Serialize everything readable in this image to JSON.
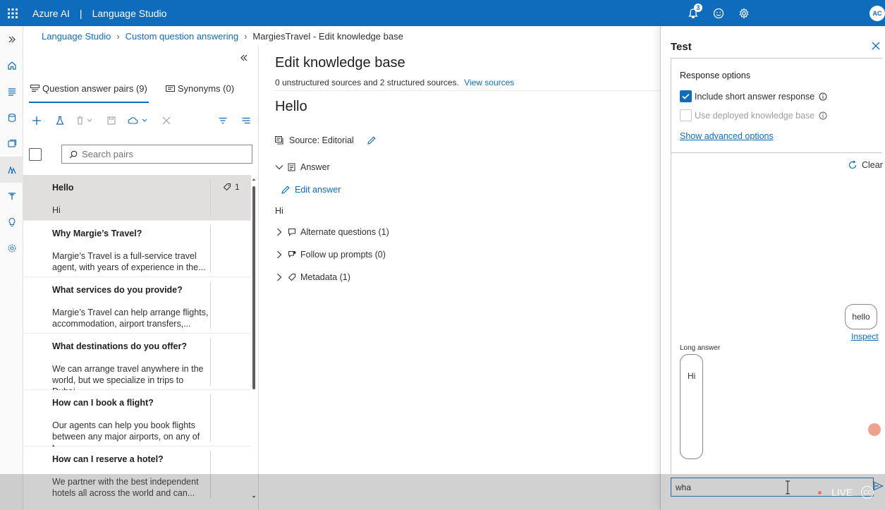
{
  "topbar": {
    "brand": "Azure AI",
    "separator": "|",
    "product": "Language Studio",
    "notification_count": "3",
    "avatar_initials": "AC"
  },
  "breadcrumb": {
    "items": [
      "Language Studio",
      "Custom question answering",
      "MargiesTravel - Edit knowledge base"
    ]
  },
  "pivots": {
    "qa_pairs": "Question answer pairs (9)",
    "synonyms": "Synonyms (0)"
  },
  "search": {
    "placeholder": "Search pairs"
  },
  "pairs": [
    {
      "question": "Hello",
      "answer": "Hi",
      "tags": "1"
    },
    {
      "question": "Why Margie’s Travel?",
      "answer": "Margie’s Travel is a full-service travel agent, with years of experience in the..."
    },
    {
      "question": "What services do you provide?",
      "answer": "Margie’s Travel can help arrange flights, accommodation, airport transfers,..."
    },
    {
      "question": "What destinations do you offer?",
      "answer": "We can arrange travel anywhere in the world, but we specialize in trips to Dubai..."
    },
    {
      "question": "How can I book a flight?",
      "answer": "Our agents can help you book flights between any major airports, on any of t..."
    },
    {
      "question": "How can I reserve a hotel?",
      "answer": "We partner with the best independent hotels all across the world and can..."
    }
  ],
  "editor": {
    "title": "Edit knowledge base",
    "sources_text": "0 unstructured sources and 2 structured sources.",
    "view_sources": "View sources",
    "qa_title": "Hello",
    "source_label": "Source: Editorial",
    "answer_label": "Answer",
    "edit_answer": "Edit answer",
    "answer_text": "Hi",
    "alternate_questions": "Alternate questions (1)",
    "follow_up": "Follow up prompts (0)",
    "metadata": "Metadata (1)"
  },
  "test": {
    "title": "Test",
    "response_options": "Response options",
    "include_short": "Include short answer response",
    "use_deployed": "Use deployed knowledge base",
    "advanced": "Show advanced options",
    "clear": "Clear",
    "user_message": "hello",
    "inspect": "Inspect",
    "long_answer_label": "Long answer",
    "bot_answer": "Hi",
    "input_value": "wha"
  },
  "overlay": {
    "live": "LIVE",
    "cc": "CC"
  },
  "colors": {
    "accent": "#0f6cbd",
    "selected_row": "#e1dfdd"
  }
}
